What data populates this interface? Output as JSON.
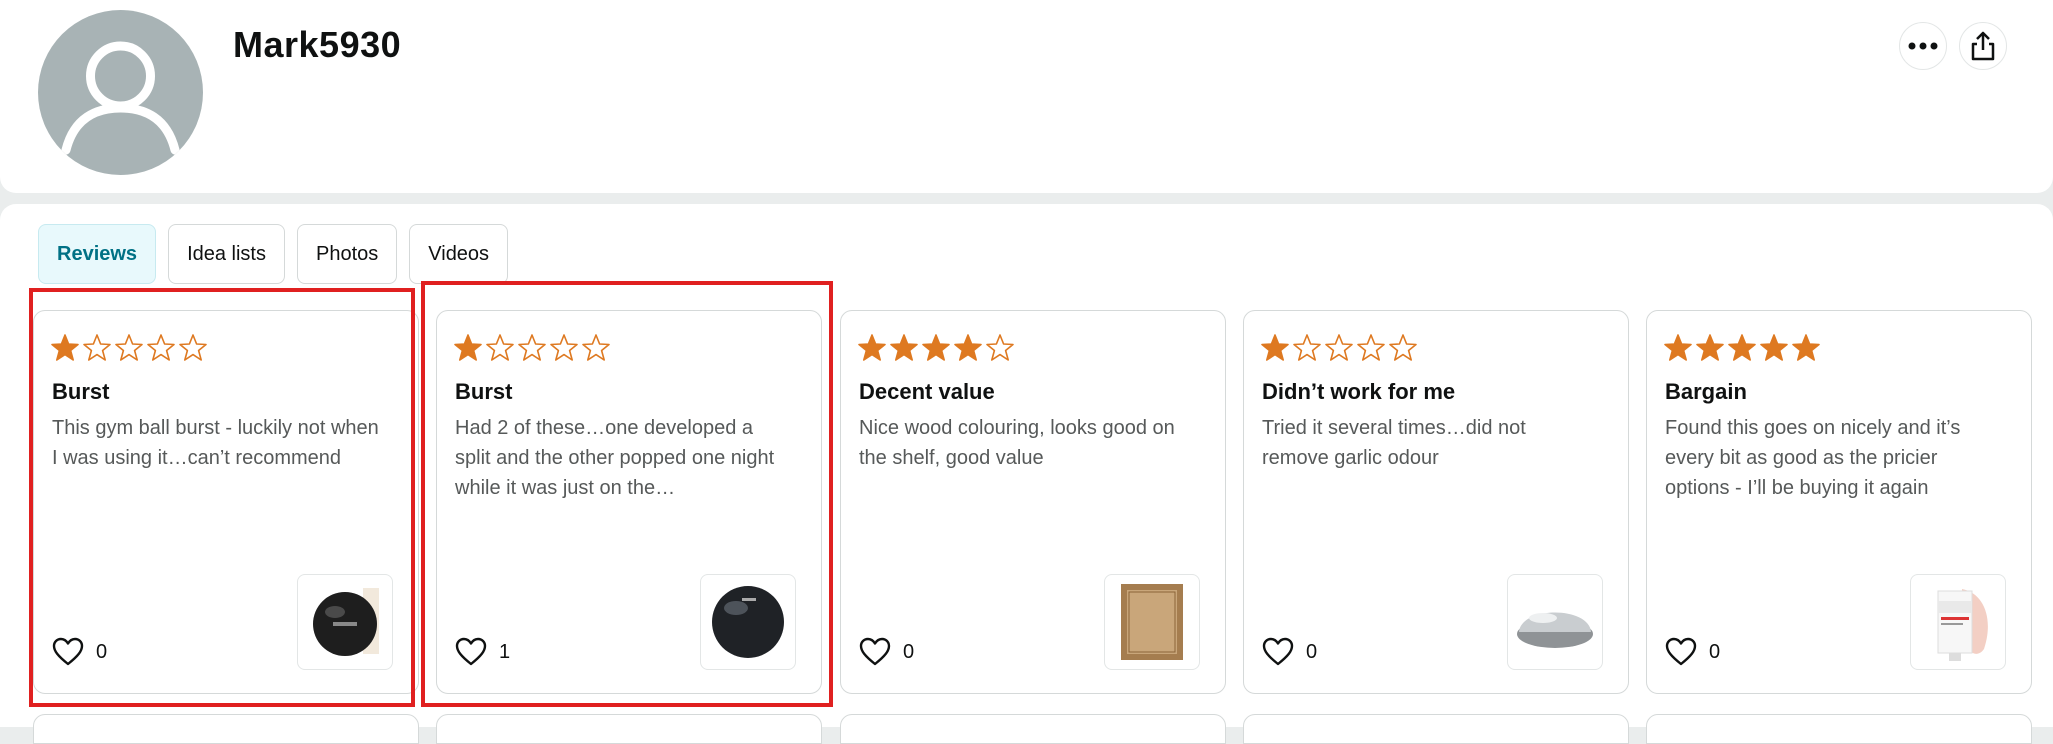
{
  "profile": {
    "username": "Mark5930"
  },
  "header_actions": {
    "more_icon": "more-horizontal-icon",
    "share_icon": "share-icon"
  },
  "tabs": [
    {
      "label": "Reviews",
      "active": true
    },
    {
      "label": "Idea lists",
      "active": false
    },
    {
      "label": "Photos",
      "active": false
    },
    {
      "label": "Videos",
      "active": false
    }
  ],
  "reviews": [
    {
      "rating": 1,
      "title": "Burst",
      "body": "This gym ball burst - luckily not when I was using it…can’t recommend",
      "likes": "0",
      "product": "black gym ball"
    },
    {
      "rating": 1,
      "title": "Burst",
      "body": "Had 2 of these…one developed a split and the other popped one night while it was just on the…",
      "likes": "1",
      "product": "black gym ball"
    },
    {
      "rating": 4,
      "title": "Decent value",
      "body": "Nice wood colouring, looks good on the shelf, good value",
      "likes": "0",
      "product": "wooden frame"
    },
    {
      "rating": 1,
      "title": "Didn’t work for me",
      "body": "Tried it several times…did not remove garlic odour",
      "likes": "0",
      "product": "stainless steel soap"
    },
    {
      "rating": 5,
      "title": "Bargain",
      "body": "Found this goes on nicely and it’s every bit as good as the pricier options - I’ll be buying it again",
      "likes": "0",
      "product": "cream tube"
    }
  ],
  "colors": {
    "star": "#de7921",
    "active_tab_text": "#007185",
    "highlight": "#e02020"
  }
}
